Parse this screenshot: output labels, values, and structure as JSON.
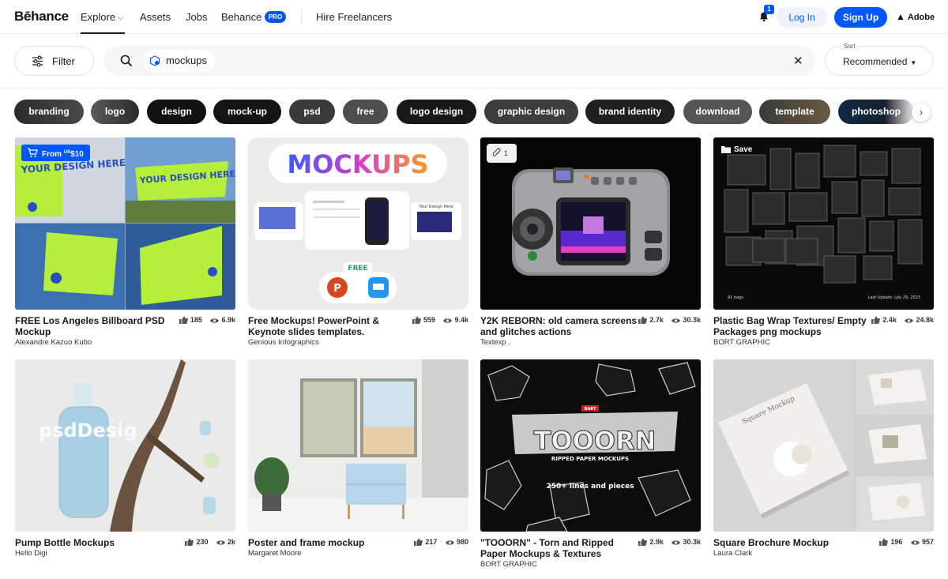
{
  "nav": {
    "logo": "Bēhance",
    "explore": "Explore",
    "assets": "Assets",
    "jobs": "Jobs",
    "behance": "Behance",
    "pro_badge": "PRO",
    "hire": "Hire Freelancers",
    "notification_count": "1",
    "login": "Log In",
    "signup": "Sign Up",
    "adobe": "Adobe"
  },
  "search": {
    "filter_label": "Filter",
    "query": "mockups",
    "sort_caption": "Sort",
    "sort_value": "Recommended"
  },
  "tags": [
    "branding",
    "logo",
    "design",
    "mock-up",
    "psd",
    "free",
    "logo design",
    "graphic design",
    "brand identity",
    "download",
    "template",
    "photoshop"
  ],
  "colors": {
    "accent": "#0057ff",
    "chip_dark": "#1c1c1c"
  },
  "cards": [
    {
      "title": "FREE Los Angeles Billboard PSD Mockup",
      "owner": "Alexandre Kazuo Kubo",
      "likes": "185",
      "views": "6.9k",
      "badge_from": "From",
      "badge_currency": "US",
      "badge_price": "$10",
      "art": {
        "text1": "YOUR DESIGN HERE",
        "text2": "YOUR DESIGN HERE"
      }
    },
    {
      "title": "Free Mockups! PowerPoint & Keynote slides templates.",
      "owner": "Genious Infographics",
      "likes": "559",
      "views": "9.4k",
      "art": {
        "headline": "MOCKUPS",
        "free": "FREE",
        "slide_title": "Your Design Here"
      }
    },
    {
      "title": "Y2K REBORN: old camera screens and glitches actions",
      "owner": "Textexp .",
      "likes": "2.7k",
      "views": "30.3k",
      "attachment_count": "1"
    },
    {
      "title": "Plastic Bag Wrap Textures/ Empty Packages png mockups",
      "owner": "BORT GRAPHIC",
      "likes": "2.4k",
      "views": "24.8k",
      "save_label": "Save",
      "art": {
        "bags": "91 bags",
        "update": "Last Update: july 29, 2023"
      }
    },
    {
      "title": "Pump Bottle Mockups",
      "owner": "Hello Digi",
      "likes": "230",
      "views": "2k",
      "art": {
        "bottle_text": "psdDesig"
      }
    },
    {
      "title": "Poster and frame mockup",
      "owner": "Margaret Moore",
      "likes": "217",
      "views": "980"
    },
    {
      "title": "\"TOOORN\" - Torn and Ripped Paper Mockups & Textures",
      "owner": "BORT GRAPHIC",
      "likes": "2.9k",
      "views": "30.3k",
      "art": {
        "headline": "TOOORN",
        "subtitle": "RIPPED PAPER MOCKUPS",
        "lines": "250+ lines and pieces",
        "tag": "BART"
      }
    },
    {
      "title": "Square Brochure Mockup",
      "owner": "Laura Clark",
      "likes": "196",
      "views": "957",
      "art": {
        "cover": "Square Mockup"
      }
    }
  ]
}
